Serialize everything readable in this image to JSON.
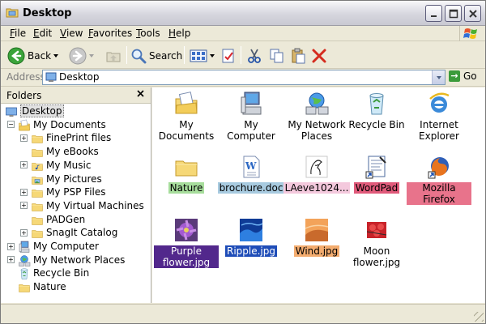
{
  "window": {
    "title": "Desktop"
  },
  "menu": [
    "File",
    "Edit",
    "View",
    "Favorites",
    "Tools",
    "Help"
  ],
  "toolbar": {
    "back_label": "Back",
    "search_label": "Search"
  },
  "address": {
    "label": "Address",
    "value": "Desktop",
    "go_label": "Go"
  },
  "folders": {
    "header": "Folders",
    "items": [
      {
        "label": "Desktop",
        "icon": "desktop-icon",
        "expander": "none",
        "selected": true
      },
      {
        "label": "My Documents",
        "icon": "my-documents-icon",
        "expander": "minus"
      },
      {
        "label": "FinePrint files",
        "icon": "folder-icon",
        "expander": "plus"
      },
      {
        "label": "My eBooks",
        "icon": "folder-icon",
        "expander": "none"
      },
      {
        "label": "My Music",
        "icon": "music-folder-icon",
        "expander": "plus"
      },
      {
        "label": "My Pictures",
        "icon": "pictures-folder-icon",
        "expander": "none"
      },
      {
        "label": "My PSP Files",
        "icon": "folder-icon",
        "expander": "plus"
      },
      {
        "label": "My Virtual Machines",
        "icon": "folder-icon",
        "expander": "plus"
      },
      {
        "label": "PADGen",
        "icon": "folder-icon",
        "expander": "none"
      },
      {
        "label": "SnagIt Catalog",
        "icon": "folder-icon",
        "expander": "plus"
      },
      {
        "label": "My Computer",
        "icon": "computer-icon",
        "expander": "plus"
      },
      {
        "label": "My Network Places",
        "icon": "network-icon",
        "expander": "plus"
      },
      {
        "label": "Recycle Bin",
        "icon": "recycle-bin-icon",
        "expander": "none"
      },
      {
        "label": "Nature",
        "icon": "folder-icon",
        "expander": "none"
      }
    ]
  },
  "items": [
    {
      "label": "My Documents",
      "icon": "my-documents-icon",
      "highlight": ""
    },
    {
      "label": "My Computer",
      "icon": "computer-icon",
      "highlight": ""
    },
    {
      "label": "My Network Places",
      "icon": "network-icon",
      "highlight": ""
    },
    {
      "label": "Recycle Bin",
      "icon": "recycle-bin-icon",
      "highlight": ""
    },
    {
      "label": "Internet Explorer",
      "icon": "internet-explorer-icon",
      "highlight": ""
    },
    {
      "label": "Nature",
      "icon": "folder-icon",
      "highlight": "#a7dd9c"
    },
    {
      "label": "brochure.doc",
      "icon": "word-document-icon",
      "highlight": "#a8cbe0"
    },
    {
      "label": "LAeve1024...",
      "icon": "image-thumbnail-icon",
      "highlight": "#f4c9dd"
    },
    {
      "label": "WordPad",
      "icon": "wordpad-icon",
      "highlight": "#e05a7a"
    },
    {
      "label": "Mozilla Firefox",
      "icon": "firefox-icon",
      "highlight": "#e8738b"
    },
    {
      "label": "Purple flower.jpg",
      "icon": "purple-flower-image-icon",
      "highlight": "#52288c"
    },
    {
      "label": "Ripple.jpg",
      "icon": "ripple-image-icon",
      "highlight": "#1f4db8"
    },
    {
      "label": "Wind.jpg",
      "icon": "wind-image-icon",
      "highlight": "#f3ac6f"
    },
    {
      "label": "Moon flower.jpg",
      "icon": "moon-flower-image-icon",
      "highlight": ""
    }
  ]
}
